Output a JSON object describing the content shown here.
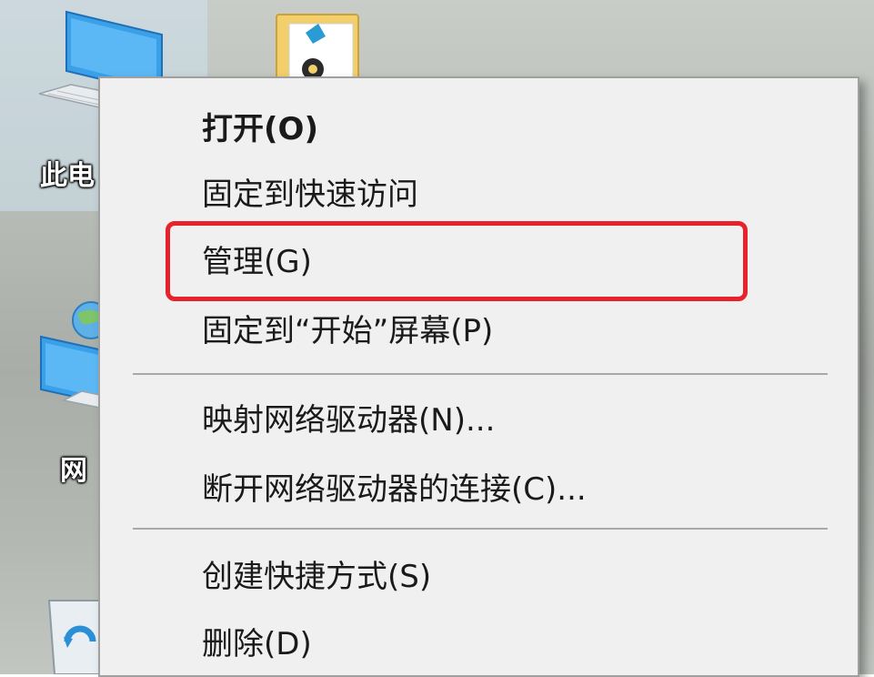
{
  "desktop": {
    "icons": {
      "this_pc_label": "此电",
      "network_label": "网"
    }
  },
  "context_menu": {
    "items": [
      {
        "label": "打开(O)",
        "default": true
      },
      {
        "label": "固定到快速访问"
      },
      {
        "label": "管理(G)",
        "highlighted": true
      },
      {
        "label": "固定到“开始”屏幕(P)"
      },
      {
        "label": "映射网络驱动器(N)..."
      },
      {
        "label": "断开网络驱动器的连接(C)..."
      },
      {
        "label": "创建快捷方式(S)"
      },
      {
        "label": "删除(D)"
      }
    ]
  },
  "colors": {
    "menu_background": "#f0f0f0",
    "highlight_border": "#e8222a",
    "separator": "#a8a8a8",
    "text": "#1a1a1a"
  }
}
